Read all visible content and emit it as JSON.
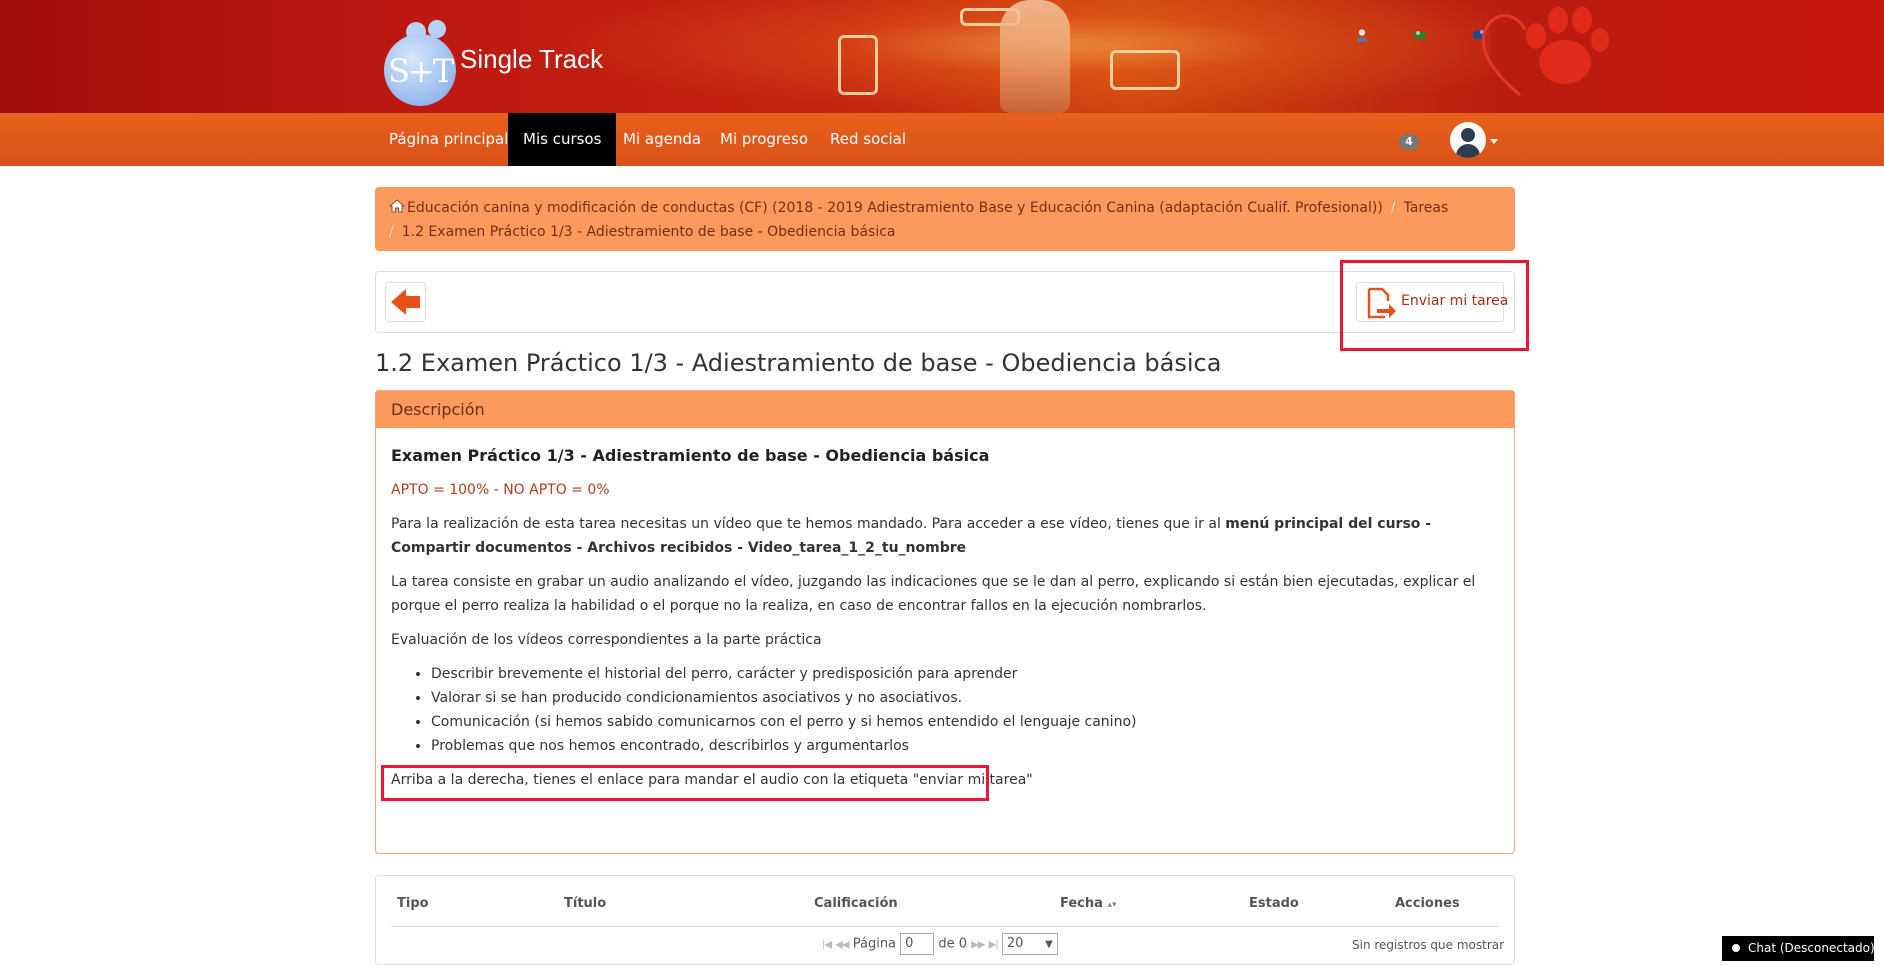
{
  "header": {
    "brand": "Single Track",
    "logo_initials": "S+T"
  },
  "nav": {
    "items": [
      {
        "label": "Página principal"
      },
      {
        "label": "Mis cursos"
      },
      {
        "label": "Mi agenda"
      },
      {
        "label": "Mi progreso"
      },
      {
        "label": "Red social"
      }
    ],
    "notifications_count": "4"
  },
  "breadcrumb": {
    "course": "Educación canina y modificación de conductas (CF) (2018 - 2019 Adiestramiento Base y Educación Canina (adaptación Cualif. Profesional))",
    "section": "Tareas",
    "current": "1.2 Examen Práctico 1/3 - Adiestramiento de base - Obediencia básica"
  },
  "actions": {
    "send_label": "Enviar mi tarea"
  },
  "page_title": "1.2 Examen Práctico 1/3 - Adiestramiento de base - Obediencia básica",
  "description": {
    "header": "Descripción",
    "heading": "Examen Práctico 1/3 - Adiestramiento de base - Obediencia básica",
    "apto": "APTO = 100% - NO APTO = 0%",
    "p1_text": "Para la realización de esta tarea necesitas un vídeo que te hemos mandado. Para acceder a ese vídeo, tienes que ir al ",
    "p1_bold": "menú principal del curso - Compartir documentos - Archivos recibidos - Video_tarea_1_2_tu_nombre",
    "p2": "La tarea consiste en grabar un audio analizando el vídeo, juzgando las indicaciones que se le dan al perro, explicando si están bien ejecutadas, explicar el porque el perro realiza la habilidad o el porque no la realiza, en caso de encontrar fallos en la ejecución nombrarlos.",
    "p3": "Evaluación de los vídeos correspondientes a la parte práctica",
    "bullets": [
      "Describir brevemente el historial del perro, carácter y predisposición para aprender",
      "Valorar si se han producido condicionamientos asociativos y no asociativos.",
      "Comunicación (si hemos sabido comunicarnos con el perro y si hemos entendido el lenguaje canino)",
      "Problemas que nos hemos encontrado, describirlos y argumentarlos"
    ],
    "note": "Arriba a la derecha, tienes el enlace para mandar el audio con la etiqueta \"enviar mi tarea\""
  },
  "table": {
    "columns": [
      "Tipo",
      "Título",
      "Calificación",
      "Fecha",
      "Estado",
      "Acciones"
    ],
    "pager": {
      "page_label": "Página",
      "page_value": "0",
      "of_label": "de 0",
      "rows_value": "20",
      "empty_text": "Sin registros que mostrar"
    }
  },
  "chat": {
    "label": "Chat (Desconectado)"
  },
  "colors": {
    "banner": "#b91d10",
    "navbar": "#e05a1b",
    "breadcrumb_bg": "#fb9a5c",
    "highlight": "#e8173a"
  }
}
